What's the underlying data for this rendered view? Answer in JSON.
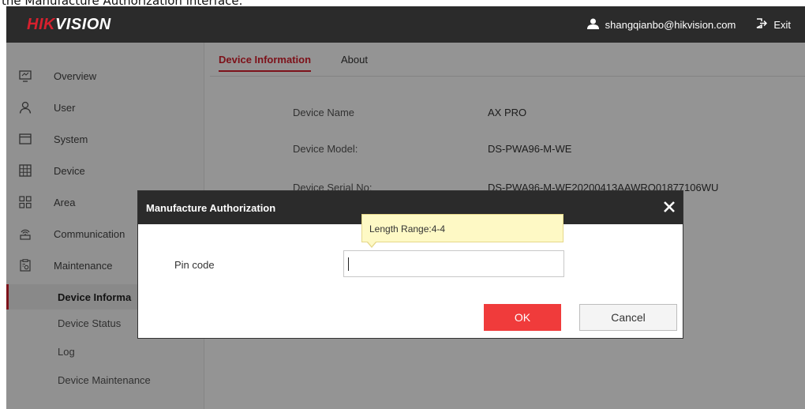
{
  "caption": "the Manufacture Authorization interface.",
  "header": {
    "logo_red": "HIK",
    "logo_white": "VISION",
    "user_email": "shangqianbo@hikvision.com",
    "exit_label": "Exit"
  },
  "sidebar": {
    "items": [
      {
        "label": "Overview",
        "icon": "monitor-icon"
      },
      {
        "label": "User",
        "icon": "user-icon"
      },
      {
        "label": "System",
        "icon": "window-icon"
      },
      {
        "label": "Device",
        "icon": "grid-device-icon"
      },
      {
        "label": "Area",
        "icon": "area-squares-icon"
      },
      {
        "label": "Communication",
        "icon": "signal-icon"
      },
      {
        "label": "Maintenance",
        "icon": "clipboard-gear-icon"
      }
    ],
    "subitems": [
      {
        "label": "Device Informa",
        "active": true
      },
      {
        "label": "Device Status",
        "active": false
      },
      {
        "label": "Log",
        "active": false
      },
      {
        "label": "Device Maintenance",
        "active": false
      }
    ]
  },
  "tabs": [
    {
      "label": "Device Information",
      "active": true
    },
    {
      "label": "About",
      "active": false
    }
  ],
  "device_info": [
    {
      "key": "Device Name",
      "value": "AX PRO"
    },
    {
      "key": "Device Model:",
      "value": "DS-PWA96-M-WE"
    },
    {
      "key": "Device Serial No:",
      "value": "DS-PWA96-M-WE20200413AAWRQ01877106WU"
    }
  ],
  "dialog": {
    "title": "Manufacture Authorization",
    "pin_label": "Pin code",
    "pin_value": "",
    "tooltip": "Length Range:4-4",
    "ok_label": "OK",
    "cancel_label": "Cancel"
  },
  "colors": {
    "accent": "#d7202e",
    "header_bg": "#2b2b2b",
    "ok_button": "#f03b3b",
    "tooltip_bg": "#fef9c5"
  }
}
